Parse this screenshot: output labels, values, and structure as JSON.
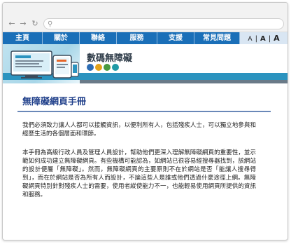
{
  "browser": {
    "address_value": "",
    "icons": {
      "back": "back-arrow-icon",
      "forward": "forward-arrow-icon",
      "reload": "reload-icon",
      "search": "search-icon"
    }
  },
  "menu": {
    "items": [
      "主頁",
      "關於",
      "聯絡",
      "服務",
      "支援",
      "常見問題"
    ]
  },
  "font_size": {
    "small": "A",
    "sep1": "|",
    "medium": "A",
    "sep2": "|",
    "large": "A"
  },
  "banner": {
    "site_title": "數碼無障礙"
  },
  "page": {
    "heading": "無障礙網頁手冊",
    "paragraphs": [
      "我們必須致力讓人人都可以接觸資訊，以便利所有人，包括殘疾人士，可以獨立地參與和經歷生活的各個層面和環節。",
      "本手冊為高級行政人員及管理人員設計，幫助他們更深入理解無障礙網頁的重要性，並示範如何成功建立無障礙網頁。有些機構可能認為，如網站已很容易經搜尋器找到，該網站的設計便屬「無障礙」。然而，無障礙網頁的主要原則不在於網站是否「能讓人搜尋得到」，而在於網站是否為所有人而設計，不論這些人是誰或他們透過什麼途徑上網。無障礙網頁特別針對殘疾人士的需要，使用者縱使能力不一，也能輕易使用網頁所提供的資訊和服務。"
    ]
  },
  "colors": {
    "menu_bg": "#1a6fb8",
    "heading": "#1f3f8a",
    "banner_stripe": "#2b93bf"
  }
}
